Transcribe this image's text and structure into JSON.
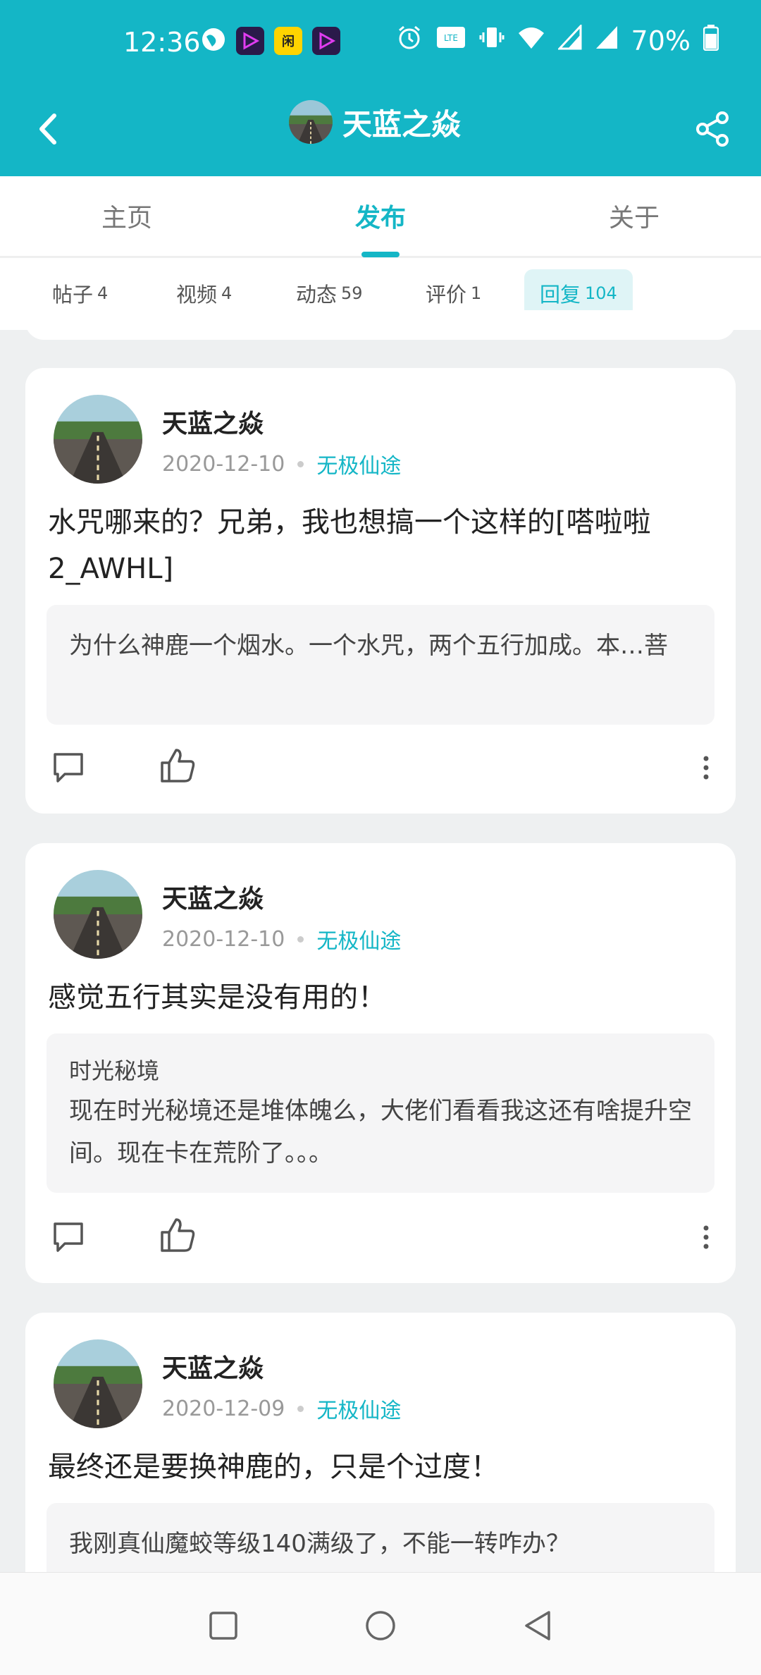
{
  "status_bar": {
    "time": "12:36",
    "battery": "70%",
    "icons": [
      "vpn-globe-icon",
      "video-app-icon",
      "news-app-icon",
      "video-app-icon",
      "alarm-icon",
      "volte-icon",
      "vibrate-icon",
      "wifi-icon",
      "signal-icon",
      "signal-icon",
      "battery-icon"
    ]
  },
  "header": {
    "title": "天蓝之焱"
  },
  "tabs": [
    {
      "label": "主页"
    },
    {
      "label": "发布"
    },
    {
      "label": "关于"
    }
  ],
  "filters": [
    {
      "label": "帖子",
      "count": "4"
    },
    {
      "label": "视频",
      "count": "4"
    },
    {
      "label": "动态",
      "count": "59"
    },
    {
      "label": "评价",
      "count": "1"
    },
    {
      "label": "回复",
      "count": "104"
    }
  ],
  "posts": [
    {
      "author": "天蓝之焱",
      "date": "2020-12-10",
      "forum": "无极仙途",
      "text": "水咒哪来的？兄弟，我也想搞一个这样的[嗒啦啦2_AWHL]",
      "quote": "为什么神鹿一个烟水。一个水咒，两个五行加成。本…菩"
    },
    {
      "author": "天蓝之焱",
      "date": "2020-12-10",
      "forum": "无极仙途",
      "text": "感觉五行其实是没有用的！",
      "quote_title": "时光秘境",
      "quote": "现在时光秘境还是堆体魄么，大佬们看看我这还有啥提升空间。现在卡在荒阶了。。。"
    },
    {
      "author": "天蓝之焱",
      "date": "2020-12-09",
      "forum": "无极仙途",
      "text": "最终还是要换神鹿的，只是个过度！",
      "quote": "我刚真仙魔蛟等级140满级了，不能一转咋办？"
    }
  ],
  "colors": {
    "accent": "#14b6c6",
    "background": "#eef0f1"
  }
}
